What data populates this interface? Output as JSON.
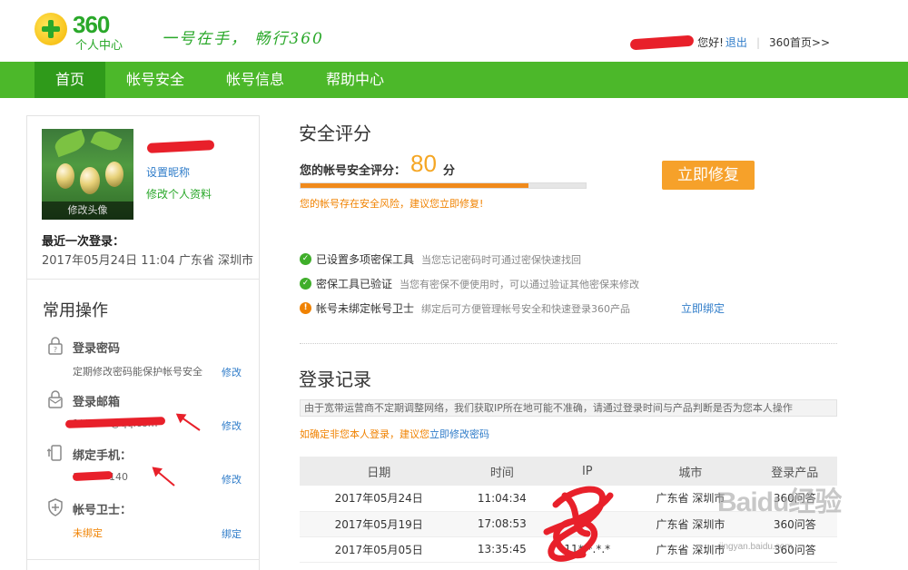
{
  "header": {
    "logo_text": "360",
    "logo_sub": "个人中心",
    "slogan": "一号在手， 畅行360",
    "greeting": "您好!",
    "logout": "退出",
    "home_link": "360首页>>"
  },
  "nav": {
    "items": [
      {
        "label": "首页",
        "active": true
      },
      {
        "label": "帐号安全",
        "active": false
      },
      {
        "label": "帐号信息",
        "active": false
      },
      {
        "label": "帮助中心",
        "active": false
      }
    ]
  },
  "profile": {
    "avatar_caption": "修改头像",
    "set_nickname": "设置昵称",
    "edit_profile": "修改个人资料",
    "last_login_label": "最近一次登录：",
    "last_login_value": "2017年05月24日 11:04 广东省 深圳市"
  },
  "ops": {
    "title": "常用操作",
    "items": [
      {
        "title": "登录密码",
        "desc": "定期修改密码能保护帐号安全",
        "action": "修改"
      },
      {
        "title": "登录邮箱",
        "desc": "1*****5@qq.com",
        "action": "修改"
      },
      {
        "title": "绑定手机：",
        "desc": "1******140",
        "action": "修改"
      },
      {
        "title": "帐号卫士：",
        "desc": "未绑定",
        "action": "绑定"
      }
    ]
  },
  "security": {
    "title": "安全评分",
    "score_label": "您的帐号安全评分：",
    "score": 80,
    "score_unit": "分",
    "progress_pct": 80,
    "warning": "您的帐号存在安全风险，建议您立即修复!",
    "fix_button": "立即修复",
    "checks": [
      {
        "status": "ok",
        "title": "已设置多项密保工具",
        "desc": "当您忘记密码时可通过密保快速找回"
      },
      {
        "status": "ok",
        "title": "密保工具已验证",
        "desc": "当您有密保不便使用时，可以通过验证其他密保来修改"
      },
      {
        "status": "warn",
        "title": "帐号未绑定帐号卫士",
        "desc": "绑定后可方便管理帐号安全和快速登录360产品"
      }
    ],
    "bind_now": "立即绑定"
  },
  "records": {
    "title": "登录记录",
    "notice": "由于宽带运营商不定期调整网络，我们获取IP所在地可能不准确，请通过登录时间与产品判断是否为您本人操作",
    "notice2_prefix": "如确定非您本人登录，建议您",
    "notice2_link": "立即修改密码",
    "columns": [
      "日期",
      "时间",
      "IP",
      "城市",
      "登录产品"
    ],
    "rows": [
      {
        "date": "2017年05月24日",
        "time": "11:04:34",
        "ip": "",
        "city": "广东省 深圳市",
        "product": "360问答"
      },
      {
        "date": "2017年05月19日",
        "time": "17:08:53",
        "ip": "",
        "city": "广东省 深圳市",
        "product": "360问答"
      },
      {
        "date": "2017年05月05日",
        "time": "13:35:45",
        "ip": "11*.*.*.*",
        "city": "广东省 深圳市",
        "product": "360问答"
      }
    ]
  },
  "watermark": {
    "text": "Baidu经验",
    "sub": "jingyan.baidu.com"
  }
}
